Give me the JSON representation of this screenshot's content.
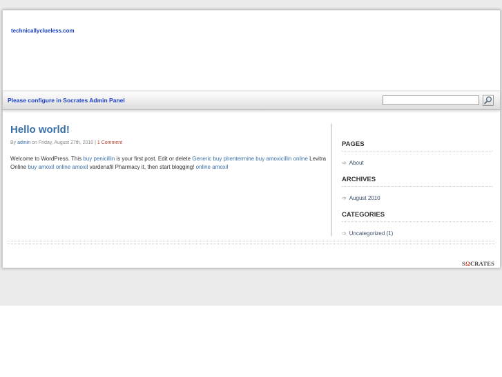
{
  "site": {
    "title": "technicallyclueless.com"
  },
  "nav": {
    "message": "Please configure in Socrates Admin Panel",
    "search_placeholder": ""
  },
  "post": {
    "title": "Hello world!",
    "meta": {
      "by": "By",
      "author": "admin",
      "on": "on Friday, August 27th, 2010 |",
      "comments": "1 Comment"
    },
    "body": [
      {
        "t": "Welcome to WordPress. This "
      },
      {
        "t": "buy penicillin",
        "link": true
      },
      {
        "t": " is your first post. Edit or delete "
      },
      {
        "t": "Generic buy phentermine",
        "link": true
      },
      {
        "t": " "
      },
      {
        "t": "buy amoxicillin online",
        "link": true
      },
      {
        "t": " Levitra Online "
      },
      {
        "t": "buy amoxil online",
        "link": true
      },
      {
        "t": " "
      },
      {
        "t": "amoxil",
        "link": true
      },
      {
        "t": " vardenafil Pharmacy it, then start blogging! "
      },
      {
        "t": "online amoxil",
        "link": true
      }
    ]
  },
  "sidebar": {
    "sections": [
      {
        "heading": "PAGES",
        "items": [
          "About"
        ]
      },
      {
        "heading": "ARCHIVES",
        "items": [
          "August 2010"
        ]
      },
      {
        "heading": "CATEGORIES",
        "items": [
          "Uncategorized (1)"
        ]
      }
    ]
  },
  "footer": {
    "logo_prefix": "S",
    "logo_omega": "Ω",
    "logo_suffix": "CRATES"
  },
  "icons": {
    "search": "search-icon",
    "arrow": "arrow-right-icon"
  }
}
